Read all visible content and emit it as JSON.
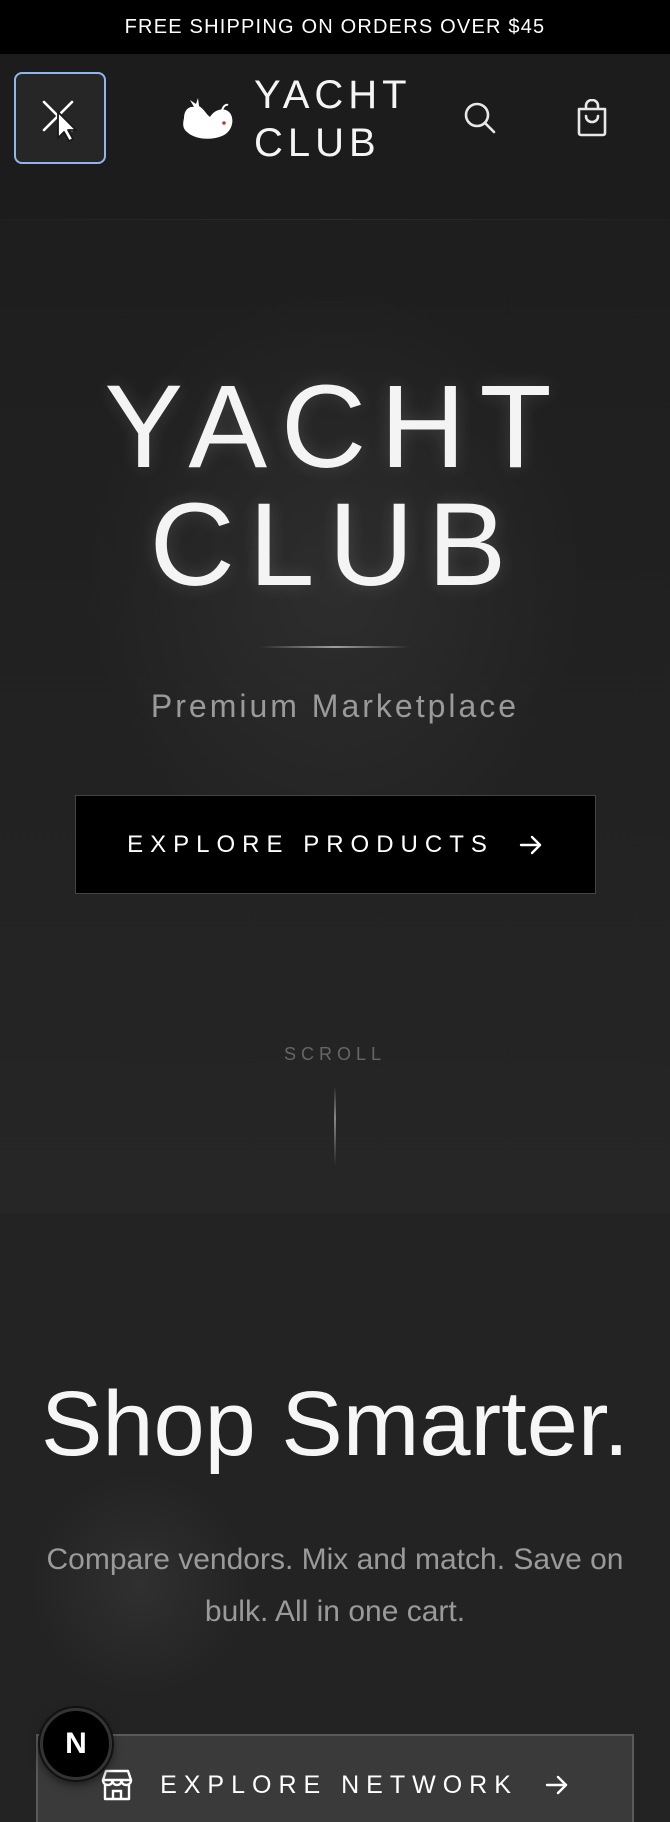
{
  "announcement": "FREE SHIPPING ON ORDERS OVER $45",
  "header": {
    "brand_line1": "YACHT",
    "brand_line2": "CLUB",
    "menu_icon": "close-cursor-icon",
    "logo_icon": "whale-icon",
    "search_icon": "search-icon",
    "cart_icon": "shopping-bag-icon",
    "accent_color": "#8fb6ee"
  },
  "hero": {
    "title_line1": "YACHT",
    "title_line2": "CLUB",
    "subtitle": "Premium Marketplace",
    "cta_label": "EXPLORE PRODUCTS",
    "cta_icon": "arrow-right-icon",
    "scroll_label": "SCROLL"
  },
  "section2": {
    "title": "Shop Smarter.",
    "text": "Compare vendors. Mix and match. Save on bulk. All in one cart.",
    "cta_label": "EXPLORE NETWORK",
    "cta_leading_icon": "store-icon",
    "cta_trailing_icon": "arrow-right-icon"
  },
  "badge": {
    "label": "N"
  }
}
